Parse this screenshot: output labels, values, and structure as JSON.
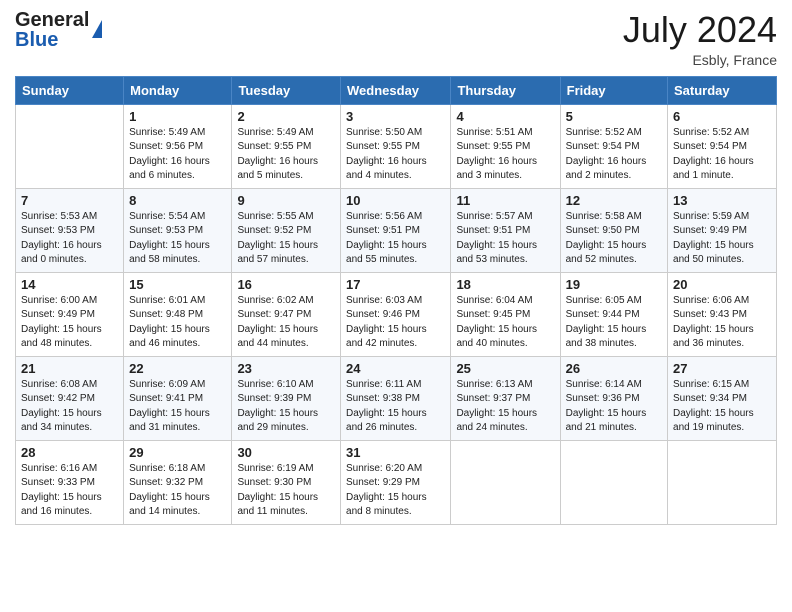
{
  "header": {
    "logo_general": "General",
    "logo_blue": "Blue",
    "month_year": "July 2024",
    "location": "Esbly, France"
  },
  "days_of_week": [
    "Sunday",
    "Monday",
    "Tuesday",
    "Wednesday",
    "Thursday",
    "Friday",
    "Saturday"
  ],
  "weeks": [
    [
      {
        "day": "",
        "info": ""
      },
      {
        "day": "1",
        "info": "Sunrise: 5:49 AM\nSunset: 9:56 PM\nDaylight: 16 hours\nand 6 minutes."
      },
      {
        "day": "2",
        "info": "Sunrise: 5:49 AM\nSunset: 9:55 PM\nDaylight: 16 hours\nand 5 minutes."
      },
      {
        "day": "3",
        "info": "Sunrise: 5:50 AM\nSunset: 9:55 PM\nDaylight: 16 hours\nand 4 minutes."
      },
      {
        "day": "4",
        "info": "Sunrise: 5:51 AM\nSunset: 9:55 PM\nDaylight: 16 hours\nand 3 minutes."
      },
      {
        "day": "5",
        "info": "Sunrise: 5:52 AM\nSunset: 9:54 PM\nDaylight: 16 hours\nand 2 minutes."
      },
      {
        "day": "6",
        "info": "Sunrise: 5:52 AM\nSunset: 9:54 PM\nDaylight: 16 hours\nand 1 minute."
      }
    ],
    [
      {
        "day": "7",
        "info": "Sunrise: 5:53 AM\nSunset: 9:53 PM\nDaylight: 16 hours\nand 0 minutes."
      },
      {
        "day": "8",
        "info": "Sunrise: 5:54 AM\nSunset: 9:53 PM\nDaylight: 15 hours\nand 58 minutes."
      },
      {
        "day": "9",
        "info": "Sunrise: 5:55 AM\nSunset: 9:52 PM\nDaylight: 15 hours\nand 57 minutes."
      },
      {
        "day": "10",
        "info": "Sunrise: 5:56 AM\nSunset: 9:51 PM\nDaylight: 15 hours\nand 55 minutes."
      },
      {
        "day": "11",
        "info": "Sunrise: 5:57 AM\nSunset: 9:51 PM\nDaylight: 15 hours\nand 53 minutes."
      },
      {
        "day": "12",
        "info": "Sunrise: 5:58 AM\nSunset: 9:50 PM\nDaylight: 15 hours\nand 52 minutes."
      },
      {
        "day": "13",
        "info": "Sunrise: 5:59 AM\nSunset: 9:49 PM\nDaylight: 15 hours\nand 50 minutes."
      }
    ],
    [
      {
        "day": "14",
        "info": "Sunrise: 6:00 AM\nSunset: 9:49 PM\nDaylight: 15 hours\nand 48 minutes."
      },
      {
        "day": "15",
        "info": "Sunrise: 6:01 AM\nSunset: 9:48 PM\nDaylight: 15 hours\nand 46 minutes."
      },
      {
        "day": "16",
        "info": "Sunrise: 6:02 AM\nSunset: 9:47 PM\nDaylight: 15 hours\nand 44 minutes."
      },
      {
        "day": "17",
        "info": "Sunrise: 6:03 AM\nSunset: 9:46 PM\nDaylight: 15 hours\nand 42 minutes."
      },
      {
        "day": "18",
        "info": "Sunrise: 6:04 AM\nSunset: 9:45 PM\nDaylight: 15 hours\nand 40 minutes."
      },
      {
        "day": "19",
        "info": "Sunrise: 6:05 AM\nSunset: 9:44 PM\nDaylight: 15 hours\nand 38 minutes."
      },
      {
        "day": "20",
        "info": "Sunrise: 6:06 AM\nSunset: 9:43 PM\nDaylight: 15 hours\nand 36 minutes."
      }
    ],
    [
      {
        "day": "21",
        "info": "Sunrise: 6:08 AM\nSunset: 9:42 PM\nDaylight: 15 hours\nand 34 minutes."
      },
      {
        "day": "22",
        "info": "Sunrise: 6:09 AM\nSunset: 9:41 PM\nDaylight: 15 hours\nand 31 minutes."
      },
      {
        "day": "23",
        "info": "Sunrise: 6:10 AM\nSunset: 9:39 PM\nDaylight: 15 hours\nand 29 minutes."
      },
      {
        "day": "24",
        "info": "Sunrise: 6:11 AM\nSunset: 9:38 PM\nDaylight: 15 hours\nand 26 minutes."
      },
      {
        "day": "25",
        "info": "Sunrise: 6:13 AM\nSunset: 9:37 PM\nDaylight: 15 hours\nand 24 minutes."
      },
      {
        "day": "26",
        "info": "Sunrise: 6:14 AM\nSunset: 9:36 PM\nDaylight: 15 hours\nand 21 minutes."
      },
      {
        "day": "27",
        "info": "Sunrise: 6:15 AM\nSunset: 9:34 PM\nDaylight: 15 hours\nand 19 minutes."
      }
    ],
    [
      {
        "day": "28",
        "info": "Sunrise: 6:16 AM\nSunset: 9:33 PM\nDaylight: 15 hours\nand 16 minutes."
      },
      {
        "day": "29",
        "info": "Sunrise: 6:18 AM\nSunset: 9:32 PM\nDaylight: 15 hours\nand 14 minutes."
      },
      {
        "day": "30",
        "info": "Sunrise: 6:19 AM\nSunset: 9:30 PM\nDaylight: 15 hours\nand 11 minutes."
      },
      {
        "day": "31",
        "info": "Sunrise: 6:20 AM\nSunset: 9:29 PM\nDaylight: 15 hours\nand 8 minutes."
      },
      {
        "day": "",
        "info": ""
      },
      {
        "day": "",
        "info": ""
      },
      {
        "day": "",
        "info": ""
      }
    ]
  ]
}
